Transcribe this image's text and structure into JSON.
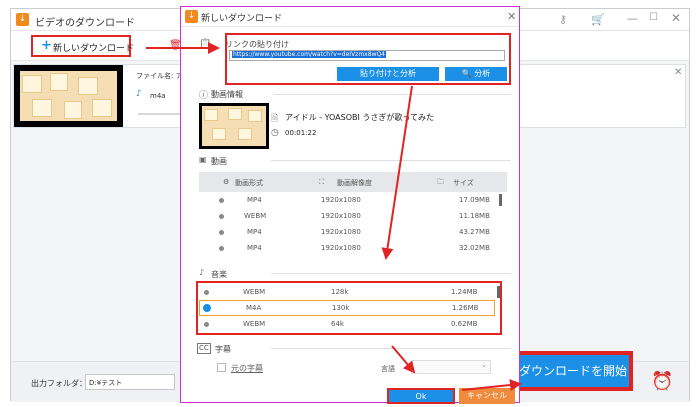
{
  "main": {
    "title": "ビデオのダウンロード",
    "new_download": "新しいダウンロード",
    "file_name_label": "ファイル名: アイ",
    "format": "m4a",
    "output_label": "出力フォルダ：",
    "output_path": "D:¥テスト",
    "start_button": "ダウンロードを開始"
  },
  "dialog": {
    "title": "新しいダウンロード",
    "paste_section": "リンクの貼り付け",
    "url": "https://www.youtube.com/watch?v=deIVzmx8wQ4",
    "paste_analyze": "貼り付けと分析",
    "analyze": "分析",
    "video_info": "動画情報",
    "video_title": "アイドル - YOASOBI うさぎが歌ってみた",
    "duration": "00:01:22",
    "video_section": "動画",
    "col_format": "動画形式",
    "col_resolution": "動画解像度",
    "col_size": "サイズ",
    "video_rows": [
      {
        "format": "MP4",
        "res": "1920x1080",
        "size": "17.09MB"
      },
      {
        "format": "WEBM",
        "res": "1920x1080",
        "size": "11.18MB"
      },
      {
        "format": "MP4",
        "res": "1920x1080",
        "size": "43.27MB"
      },
      {
        "format": "MP4",
        "res": "1920x1080",
        "size": "32.02MB"
      }
    ],
    "audio_section": "音楽",
    "audio_rows": [
      {
        "format": "WEBM",
        "rate": "128k",
        "size": "1.24MB"
      },
      {
        "format": "M4A",
        "rate": "130k",
        "size": "1.26MB"
      },
      {
        "format": "WEBM",
        "rate": "64k",
        "size": "0.62MB"
      }
    ],
    "subtitle_section": "字幕",
    "original_subtitle": "元の字幕",
    "language_label": "言語",
    "ok": "Ok",
    "cancel": "キャンセル"
  },
  "colors": {
    "accent": "#1c8fe6",
    "highlight": "#e02424",
    "dialog_border": "#d42fd4"
  }
}
